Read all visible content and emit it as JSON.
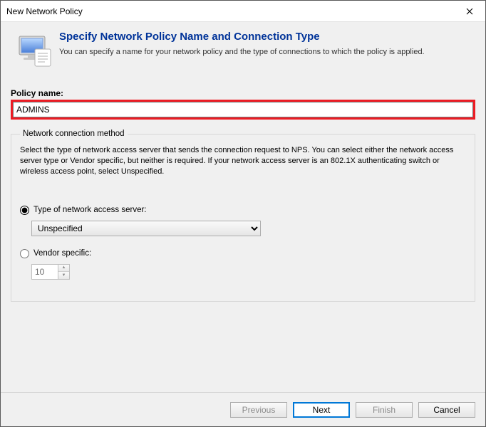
{
  "window": {
    "title": "New Network Policy"
  },
  "header": {
    "heading": "Specify Network Policy Name and Connection Type",
    "description": "You can specify a name for your network policy and the type of connections to which the policy is applied."
  },
  "form": {
    "policy_name_label": "Policy name:",
    "policy_name_value": "ADMINS",
    "group": {
      "legend": "Network connection method",
      "description": "Select the type of network access server that sends the connection request to NPS. You can select either the network access server type or Vendor specific, but neither is required.  If your network access server is an 802.1X authenticating switch or wireless access point, select Unspecified.",
      "radio_type_label": "Type of network access server:",
      "type_selected": "Unspecified",
      "type_options": [
        "Unspecified"
      ],
      "radio_vendor_label": "Vendor specific:",
      "vendor_value": "10",
      "selected_radio": "type"
    }
  },
  "footer": {
    "previous": "Previous",
    "next": "Next",
    "finish": "Finish",
    "cancel": "Cancel"
  }
}
